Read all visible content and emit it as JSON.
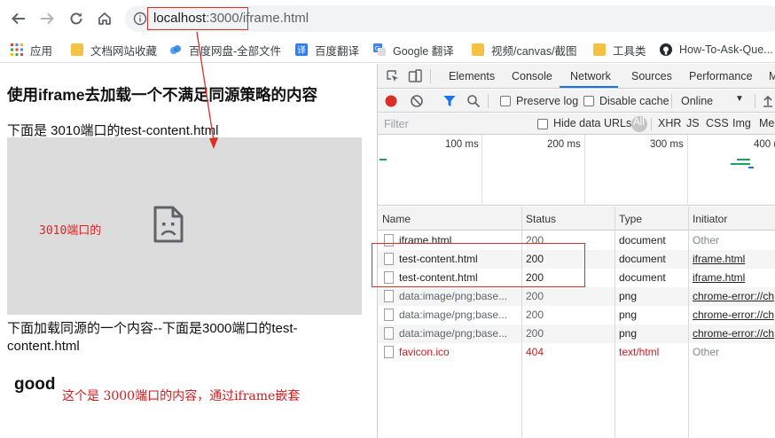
{
  "browser": {
    "url_host": "localhost",
    "url_port": ":3000",
    "url_path": "/iframe.html"
  },
  "bookmarks": [
    {
      "label": "应用",
      "icon": "apps-grid-icon"
    },
    {
      "label": "文档网站收藏",
      "icon": "folder-icon"
    },
    {
      "label": "百度网盘-全部文件",
      "icon": "baidu-netdisk-icon"
    },
    {
      "label": "百度翻译",
      "icon": "baidu-translate-icon"
    },
    {
      "label": "Google 翻译",
      "icon": "google-translate-icon"
    },
    {
      "label": "视频/canvas/截图",
      "icon": "folder-icon"
    },
    {
      "label": "工具类",
      "icon": "folder-icon"
    },
    {
      "label": "How-To-Ask-Que...",
      "icon": "github-icon"
    }
  ],
  "page": {
    "heading": "使用iframe去加载一个不满足同源策略的内容",
    "line1": "下面是 3010端口的test-content.html",
    "iframe_label": "3010端口的",
    "line2": "下面加载同源的一个内容--下面是3000端口的test-content.html",
    "good": "good",
    "red_text": "这个是 3000端口的内容，通过iframe嵌套"
  },
  "devtools": {
    "tabs": [
      "Elements",
      "Console",
      "Network",
      "Sources",
      "Performance",
      "M"
    ],
    "active_tab": "Network",
    "preserve_log": "Preserve log",
    "disable_cache": "Disable cache",
    "throttle": "Online",
    "filter_placeholder": "Filter",
    "hide_data_urls": "Hide data URLs",
    "filter_types": [
      "All",
      "XHR",
      "JS",
      "CSS",
      "Img",
      "Med"
    ],
    "timeline_labels": [
      "100 ms",
      "200 ms",
      "300 ms",
      "400 ("
    ],
    "columns": [
      "Name",
      "Status",
      "Type",
      "Initiator"
    ],
    "rows": [
      {
        "name": "iframe.html",
        "status": "200",
        "type": "document",
        "initiator": "Other"
      },
      {
        "name": "test-content.html",
        "status": "200",
        "type": "document",
        "initiator": "iframe.html"
      },
      {
        "name": "test-content.html",
        "status": "200",
        "type": "document",
        "initiator": "iframe.html"
      },
      {
        "name": "data:image/png;base...",
        "status": "200",
        "type": "png",
        "initiator": "chrome-error://ch"
      },
      {
        "name": "data:image/png;base...",
        "status": "200",
        "type": "png",
        "initiator": "chrome-error://ch"
      },
      {
        "name": "data:image/png;base...",
        "status": "200",
        "type": "png",
        "initiator": "chrome-error://ch"
      },
      {
        "name": "favicon.ico",
        "status": "404",
        "type": "text/html",
        "initiator": "Other"
      }
    ]
  },
  "colors": {
    "annotation_red": "#d93025",
    "accent_blue": "#1a73e8",
    "error_red": "#d01a1a"
  }
}
